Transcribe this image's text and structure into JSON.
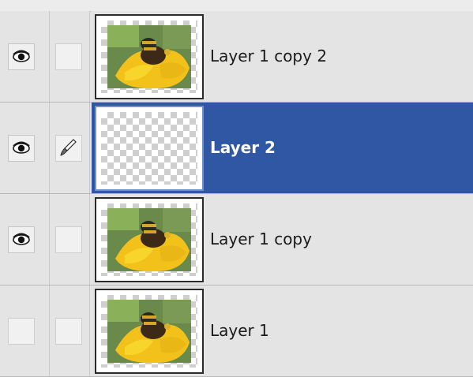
{
  "layers_panel": {
    "layers": [
      {
        "name": "Layer 1 copy 2",
        "visible": true,
        "selected": false,
        "link_icon": "none",
        "thumbnail": "flower-thumbnail"
      },
      {
        "name": "Layer 2",
        "visible": true,
        "selected": true,
        "link_icon": "brush-icon",
        "thumbnail": "transparent-thumbnail"
      },
      {
        "name": "Layer 1 copy",
        "visible": true,
        "selected": false,
        "link_icon": "none",
        "thumbnail": "flower-thumbnail"
      },
      {
        "name": "Layer 1",
        "visible": false,
        "selected": false,
        "link_icon": "none",
        "thumbnail": "flower-thumbnail"
      }
    ]
  },
  "colors": {
    "panel_bg": "#e4e4e4",
    "selected_row": "#2f57a4",
    "selected_text": "#ffffff",
    "text": "#1a1a1a"
  }
}
